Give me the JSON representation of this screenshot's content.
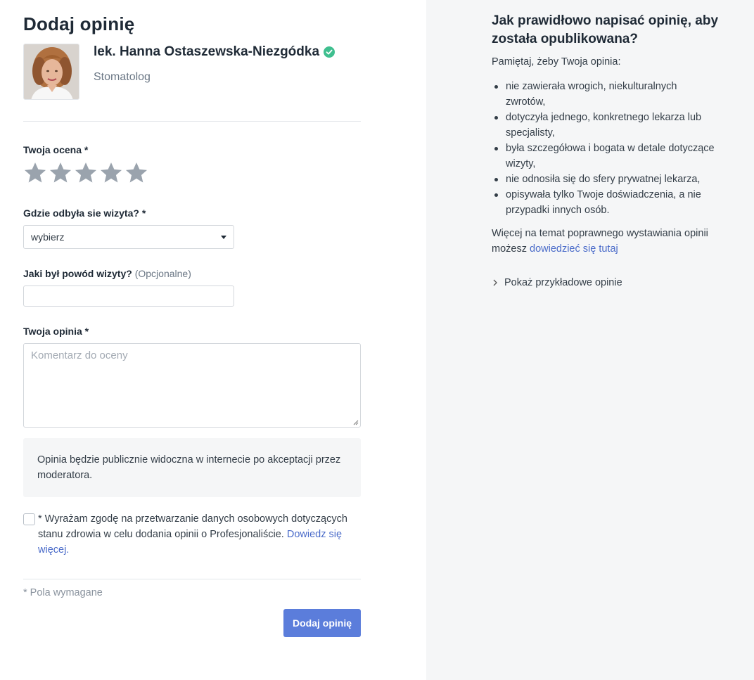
{
  "page": {
    "title": "Dodaj opinię"
  },
  "doctor": {
    "name": "lek. Hanna Ostaszewska-Niezgódka",
    "specialty": "Stomatolog",
    "verified_icon": "verified-check-icon"
  },
  "rating": {
    "label": "Twoja ocena *",
    "max": 5,
    "value": 0
  },
  "location": {
    "label": "Gdzie odbyła sie wizyta? *",
    "selected": "wybierz"
  },
  "reason": {
    "label": "Jaki był powód wizyty?",
    "optional": "(Opcjonalne)",
    "value": ""
  },
  "opinion": {
    "label": "Twoja opinia *",
    "placeholder": "Komentarz do oceny"
  },
  "notice": "Opinia będzie publicznie widoczna w internecie po akceptacji przez moderatora.",
  "consent": {
    "text": "* Wyrażam zgodę na przetwarzanie danych osobowych dotyczących stanu zdrowia w celu dodania opinii o Profesjonaliście.",
    "link": "Dowiedz się więcej.",
    "checked": false
  },
  "required_note": "* Pola wymagane",
  "submit_label": "Dodaj opinię",
  "sidebar": {
    "title": "Jak prawidłowo napisać opinię, aby została opublikowana?",
    "intro": "Pamiętaj, żeby Twoja opinia:",
    "rules": [
      "nie zawierała wrogich, niekulturalnych zwrotów,",
      "dotyczyła jednego, konkretnego lekarza lub specjalisty,",
      "była szczegółowa i bogata w detale dotyczące wizyty,",
      "nie odnosiła się do sfery prywatnej lekarza,",
      "opisywała tylko Twoje doświadczenia, a nie przypadki innych osób."
    ],
    "more_text": "Więcej na temat poprawnego wystawiania opinii możesz",
    "more_link": "dowiedzieć się tutaj",
    "toggle_label": "Pokaż przykładowe opinie"
  },
  "colors": {
    "accent": "#5b7ddb",
    "link": "#4a6bc9",
    "star": "#9aa3ad",
    "verified": "#3fbf8f",
    "panel": "#f5f6f7"
  }
}
